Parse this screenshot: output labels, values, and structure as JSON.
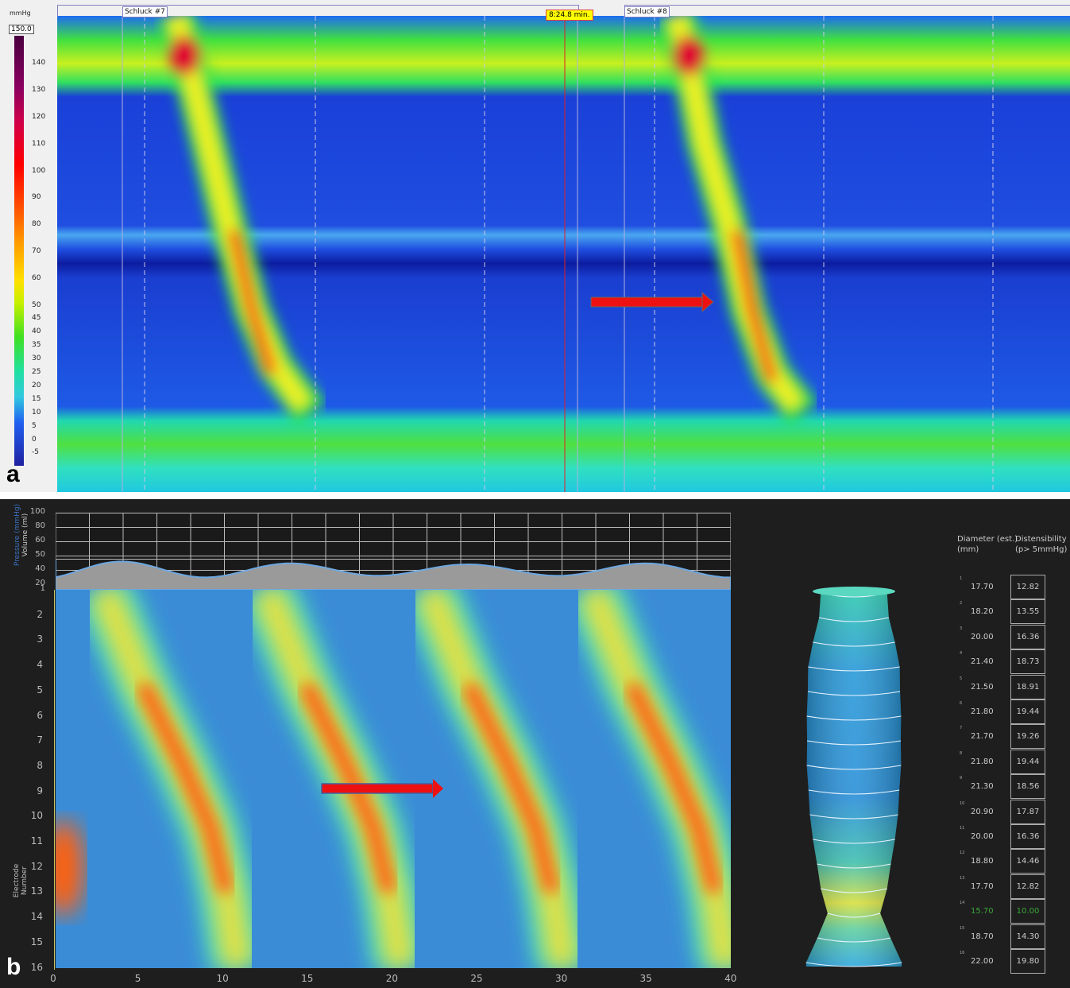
{
  "panel_a": {
    "letter": "a",
    "colorbar": {
      "unit": "mmHg",
      "max_value": "150.0",
      "ticks": [
        "140",
        "130",
        "120",
        "110",
        "100",
        "90",
        "80",
        "70",
        "60",
        "50",
        "45",
        "40",
        "35",
        "30",
        "25",
        "20",
        "15",
        "10",
        "5",
        "0",
        "-5"
      ]
    },
    "swallow_labels": [
      "Schluck #7",
      "Schluck #8"
    ],
    "cursor_time": "8:24.8 min.",
    "colors": {
      "cursor": "#e02020",
      "arrow": "#ee1111"
    }
  },
  "panel_b": {
    "letter": "b",
    "top_chart": {
      "y_label_pressure": "Pressure (mmHg)",
      "y_label_volume": "Volume (ml)",
      "ticks": [
        "100",
        "80",
        "60",
        "50",
        "40",
        "20",
        "1"
      ]
    },
    "heatmap": {
      "y_label": "Electrode Number",
      "y_ticks": [
        "2",
        "3",
        "4",
        "5",
        "6",
        "7",
        "8",
        "9",
        "10",
        "11",
        "12",
        "13",
        "14",
        "15",
        "16"
      ],
      "x_ticks": [
        "0",
        "5",
        "10",
        "15",
        "20",
        "25",
        "30",
        "35",
        "40"
      ]
    },
    "table": {
      "header_diameter": [
        "Diameter (est.)",
        "(mm)"
      ],
      "header_distensibility": [
        "Distensibility",
        "(p> 5mmHg)"
      ],
      "rows": [
        {
          "idx": "1",
          "diameter": "17.70",
          "distensibility": "12.82"
        },
        {
          "idx": "2",
          "diameter": "18.20",
          "distensibility": "13.55"
        },
        {
          "idx": "3",
          "diameter": "20.00",
          "distensibility": "16.36"
        },
        {
          "idx": "4",
          "diameter": "21.40",
          "distensibility": "18.73"
        },
        {
          "idx": "5",
          "diameter": "21.50",
          "distensibility": "18.91"
        },
        {
          "idx": "6",
          "diameter": "21.80",
          "distensibility": "19.44"
        },
        {
          "idx": "7",
          "diameter": "21.70",
          "distensibility": "19.26"
        },
        {
          "idx": "8",
          "diameter": "21.80",
          "distensibility": "19.44"
        },
        {
          "idx": "9",
          "diameter": "21.30",
          "distensibility": "18.56"
        },
        {
          "idx": "10",
          "diameter": "20.90",
          "distensibility": "17.87"
        },
        {
          "idx": "11",
          "diameter": "20.00",
          "distensibility": "16.36"
        },
        {
          "idx": "12",
          "diameter": "18.80",
          "distensibility": "14.46"
        },
        {
          "idx": "13",
          "diameter": "17.70",
          "distensibility": "12.82"
        },
        {
          "idx": "14",
          "diameter": "15.70",
          "distensibility": "10.00"
        },
        {
          "idx": "15",
          "diameter": "18.70",
          "distensibility": "14.30"
        },
        {
          "idx": "16",
          "diameter": "22.00",
          "distensibility": "19.80"
        }
      ],
      "highlight_color": "#3aa63a"
    }
  }
}
